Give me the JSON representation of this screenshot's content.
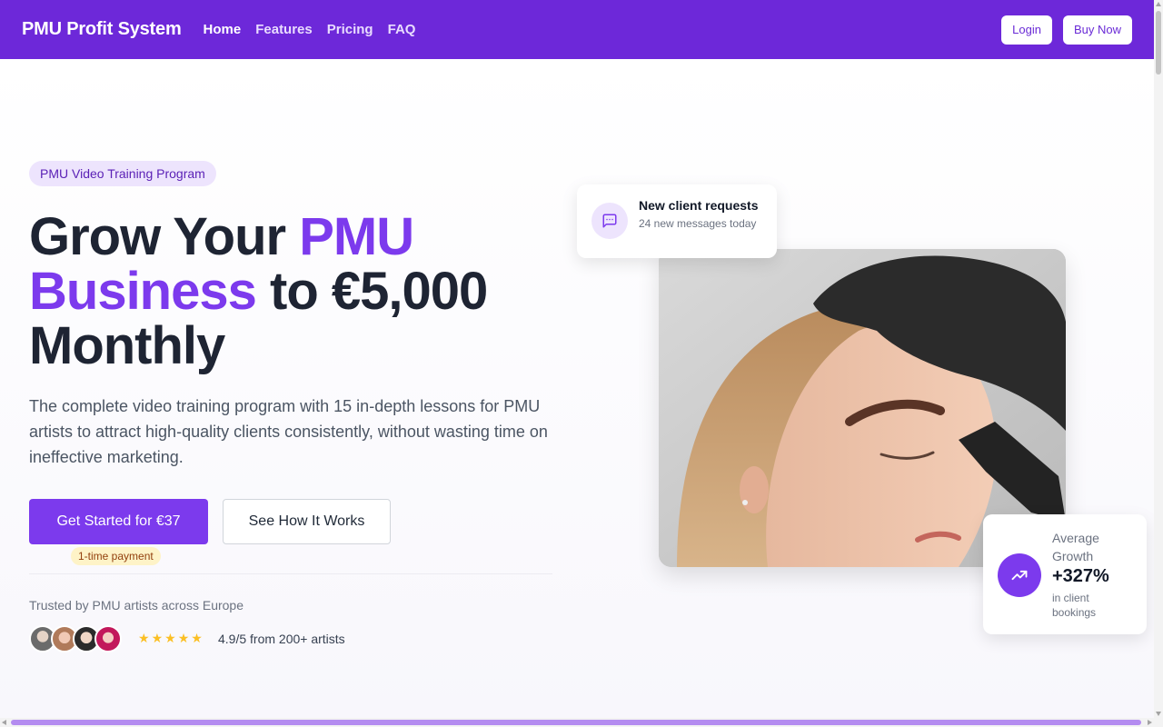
{
  "nav": {
    "brand": "PMU Profit System",
    "links": [
      {
        "label": "Home",
        "active": true
      },
      {
        "label": "Features",
        "active": false
      },
      {
        "label": "Pricing",
        "active": false
      },
      {
        "label": "FAQ",
        "active": false
      }
    ],
    "login_label": "Login",
    "buy_label": "Buy Now"
  },
  "hero": {
    "badge": "PMU Video Training Program",
    "headline_part1": "Grow Your ",
    "headline_accent": "PMU Business",
    "headline_part2": " to €5,000 Monthly",
    "subtext": "The complete video training program with 15 in-depth lessons for PMU artists to attract high-quality clients consistently, without wasting time on ineffective marketing.",
    "cta_primary": "Get Started for €37",
    "cta_secondary": "See How It Works",
    "payment_tag": "1-time payment",
    "trusted": "Trusted by PMU artists across Europe",
    "rating_text": "4.9/5 from 200+ artists",
    "star_count": 5
  },
  "card_requests": {
    "icon": "chat-message-icon",
    "title": "New client requests",
    "subtitle": "24 new messages today"
  },
  "card_growth": {
    "icon": "trending-up-icon",
    "label": "Average Growth",
    "value": "+327%",
    "note": "in client bookings"
  },
  "colors": {
    "primary": "#7c3aed",
    "navbar": "#6a2bd6",
    "star": "#fbbf24"
  }
}
